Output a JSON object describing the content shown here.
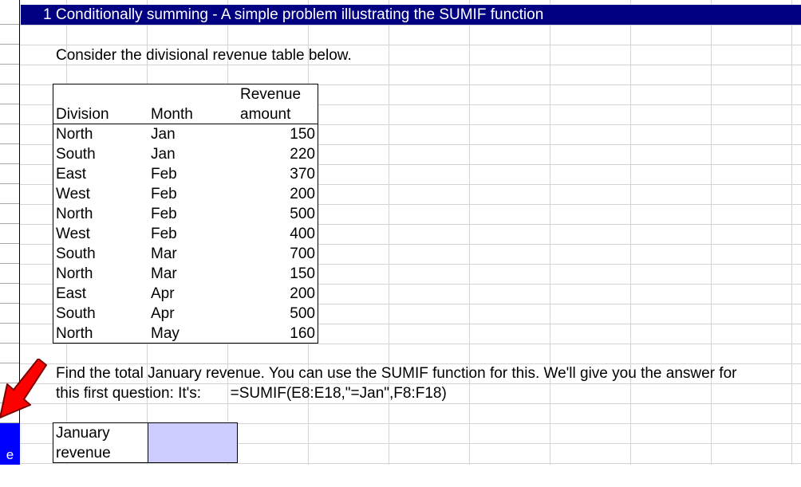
{
  "title": "1 Conditionally summing - A simple problem illustrating the SUMIF function",
  "intro": "Consider the divisional revenue table below.",
  "table": {
    "headers": {
      "division": "Division",
      "month": "Month",
      "revenue_line1": "Revenue",
      "revenue_line2": "amount"
    },
    "rows": [
      {
        "division": "North",
        "month": "Jan",
        "revenue": "150"
      },
      {
        "division": "South",
        "month": "Jan",
        "revenue": "220"
      },
      {
        "division": "East",
        "month": "Feb",
        "revenue": "370"
      },
      {
        "division": "West",
        "month": "Feb",
        "revenue": "200"
      },
      {
        "division": "North",
        "month": "Feb",
        "revenue": "500"
      },
      {
        "division": "West",
        "month": "Feb",
        "revenue": "400"
      },
      {
        "division": "South",
        "month": "Mar",
        "revenue": "700"
      },
      {
        "division": "North",
        "month": "Mar",
        "revenue": "150"
      },
      {
        "division": "East",
        "month": "Apr",
        "revenue": "200"
      },
      {
        "division": "South",
        "month": "Apr",
        "revenue": "500"
      },
      {
        "division": "North",
        "month": "May",
        "revenue": "160"
      }
    ]
  },
  "question": {
    "line1": "Find the total January revenue.  You can use the SUMIF function for this.  We'll give you the answer for",
    "line2_prefix": "this first question:  It's:",
    "formula": "=SUMIF(E8:E18,\"=Jan\",F8:F18)"
  },
  "answer": {
    "label_line1": "January",
    "label_line2": "revenue",
    "value": ""
  },
  "selected_cell_char": "e",
  "colors": {
    "title_bar": "#000080",
    "answer_fill": "#ccccff",
    "selected_cell": "#0000ff",
    "arrow": "#ff0000"
  }
}
